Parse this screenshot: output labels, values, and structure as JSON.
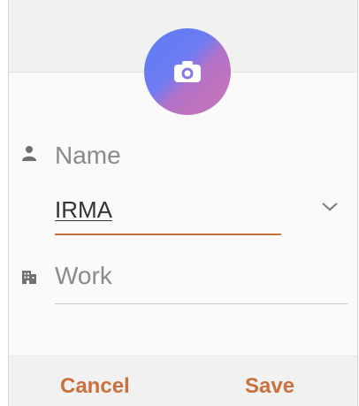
{
  "avatar": {
    "icon": "camera-icon",
    "gradient_colors": [
      "#5b7cf5",
      "#c975b3"
    ]
  },
  "name_field": {
    "label": "Name",
    "icon": "person-icon",
    "value": "IRMA",
    "expand_icon": "chevron-down-icon"
  },
  "work_field": {
    "placeholder": "Work",
    "icon": "building-icon"
  },
  "actions": {
    "cancel_label": "Cancel",
    "save_label": "Save"
  },
  "colors": {
    "accent": "#c9713d",
    "label_gray": "#8a8a8a",
    "icon_gray": "#707070"
  }
}
